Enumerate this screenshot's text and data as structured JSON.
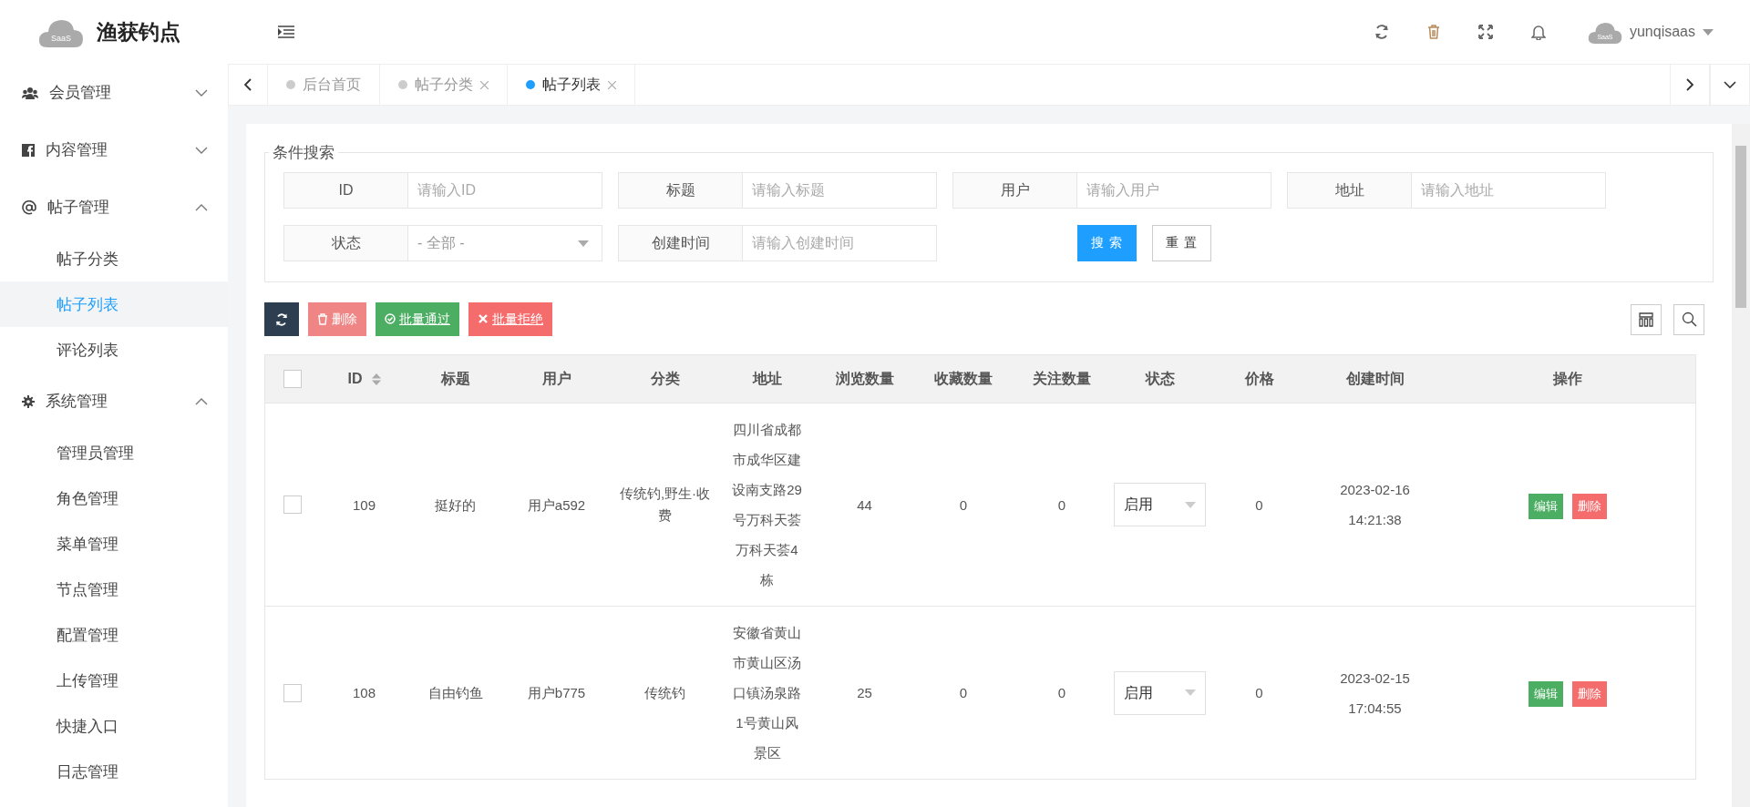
{
  "header": {
    "logo_badge": "SaaS",
    "title": "渔获钓点",
    "avatar_badge": "SaaS",
    "username": "yunqisaas"
  },
  "sidebar": {
    "items": [
      {
        "label": "会员管理",
        "expanded": false
      },
      {
        "label": "内容管理",
        "expanded": false
      },
      {
        "label": "帖子管理",
        "expanded": true,
        "children": [
          {
            "label": "帖子分类",
            "selected": false
          },
          {
            "label": "帖子列表",
            "selected": true
          },
          {
            "label": "评论列表",
            "selected": false
          }
        ]
      },
      {
        "label": "系统管理",
        "expanded": true,
        "children": [
          {
            "label": "管理员管理",
            "selected": false
          },
          {
            "label": "角色管理",
            "selected": false
          },
          {
            "label": "菜单管理",
            "selected": false
          },
          {
            "label": "节点管理",
            "selected": false
          },
          {
            "label": "配置管理",
            "selected": false
          },
          {
            "label": "上传管理",
            "selected": false
          },
          {
            "label": "快捷入口",
            "selected": false
          },
          {
            "label": "日志管理",
            "selected": false
          }
        ]
      }
    ]
  },
  "tabs": [
    {
      "label": "后台首页",
      "selected": false,
      "closable": false
    },
    {
      "label": "帖子分类",
      "selected": false,
      "closable": true
    },
    {
      "label": "帖子列表",
      "selected": true,
      "closable": true
    }
  ],
  "search": {
    "legend": "条件搜索",
    "fields": [
      {
        "kind": "input",
        "label": "ID",
        "placeholder": "请输入ID"
      },
      {
        "kind": "input",
        "label": "标题",
        "placeholder": "请输入标题"
      },
      {
        "kind": "input",
        "label": "用户",
        "placeholder": "请输入用户"
      },
      {
        "kind": "input",
        "label": "地址",
        "placeholder": "请输入地址"
      },
      {
        "kind": "select",
        "label": "状态",
        "value": "- 全部 -"
      },
      {
        "kind": "input",
        "label": "创建时间",
        "placeholder": "请输入创建时间"
      }
    ],
    "buttons": [
      {
        "kind": "primary",
        "label": "搜 索"
      },
      {
        "kind": "plain",
        "label": "重 置"
      }
    ]
  },
  "toolbar": {
    "buttons": [
      {
        "kind": "refresh"
      },
      {
        "kind": "delete",
        "label": "删除"
      },
      {
        "kind": "approve",
        "label": "批量通过"
      },
      {
        "kind": "reject",
        "label": "批量拒绝"
      }
    ]
  },
  "table": {
    "all_checked": false,
    "columns": [
      {
        "label": "ID",
        "sortable": true
      },
      {
        "label": "标题",
        "sortable": false
      },
      {
        "label": "用户",
        "sortable": false
      },
      {
        "label": "分类",
        "sortable": false
      },
      {
        "label": "地址",
        "sortable": false
      },
      {
        "label": "浏览数量",
        "sortable": false
      },
      {
        "label": "收藏数量",
        "sortable": false
      },
      {
        "label": "关注数量",
        "sortable": false
      },
      {
        "label": "状态",
        "sortable": false
      },
      {
        "label": "价格",
        "sortable": false
      },
      {
        "label": "创建时间",
        "sortable": false
      },
      {
        "label": "操作",
        "sortable": false
      }
    ],
    "rows": [
      {
        "checked": false,
        "id": "109",
        "title": "挺好的",
        "user": "用户a592",
        "category": "传统钓,野生·收费",
        "address": "四川省成都市成华区建设南支路29号万科天荟万科天荟4栋",
        "views": "44",
        "favorites": "0",
        "follows": "0",
        "status": "启用",
        "price": "0",
        "created_date": "2023-02-16",
        "created_time": "14:21:38",
        "actions": [
          "编辑",
          "删除"
        ]
      },
      {
        "checked": false,
        "id": "108",
        "title": "自由钓鱼",
        "user": "用户b775",
        "category": "传统钓",
        "address": "安徽省黄山市黄山区汤口镇汤泉路1号黄山风景区",
        "views": "25",
        "favorites": "0",
        "follows": "0",
        "status": "启用",
        "price": "0",
        "created_date": "2023-02-15",
        "created_time": "17:04:55",
        "actions": [
          "编辑",
          "删除"
        ]
      }
    ]
  }
}
